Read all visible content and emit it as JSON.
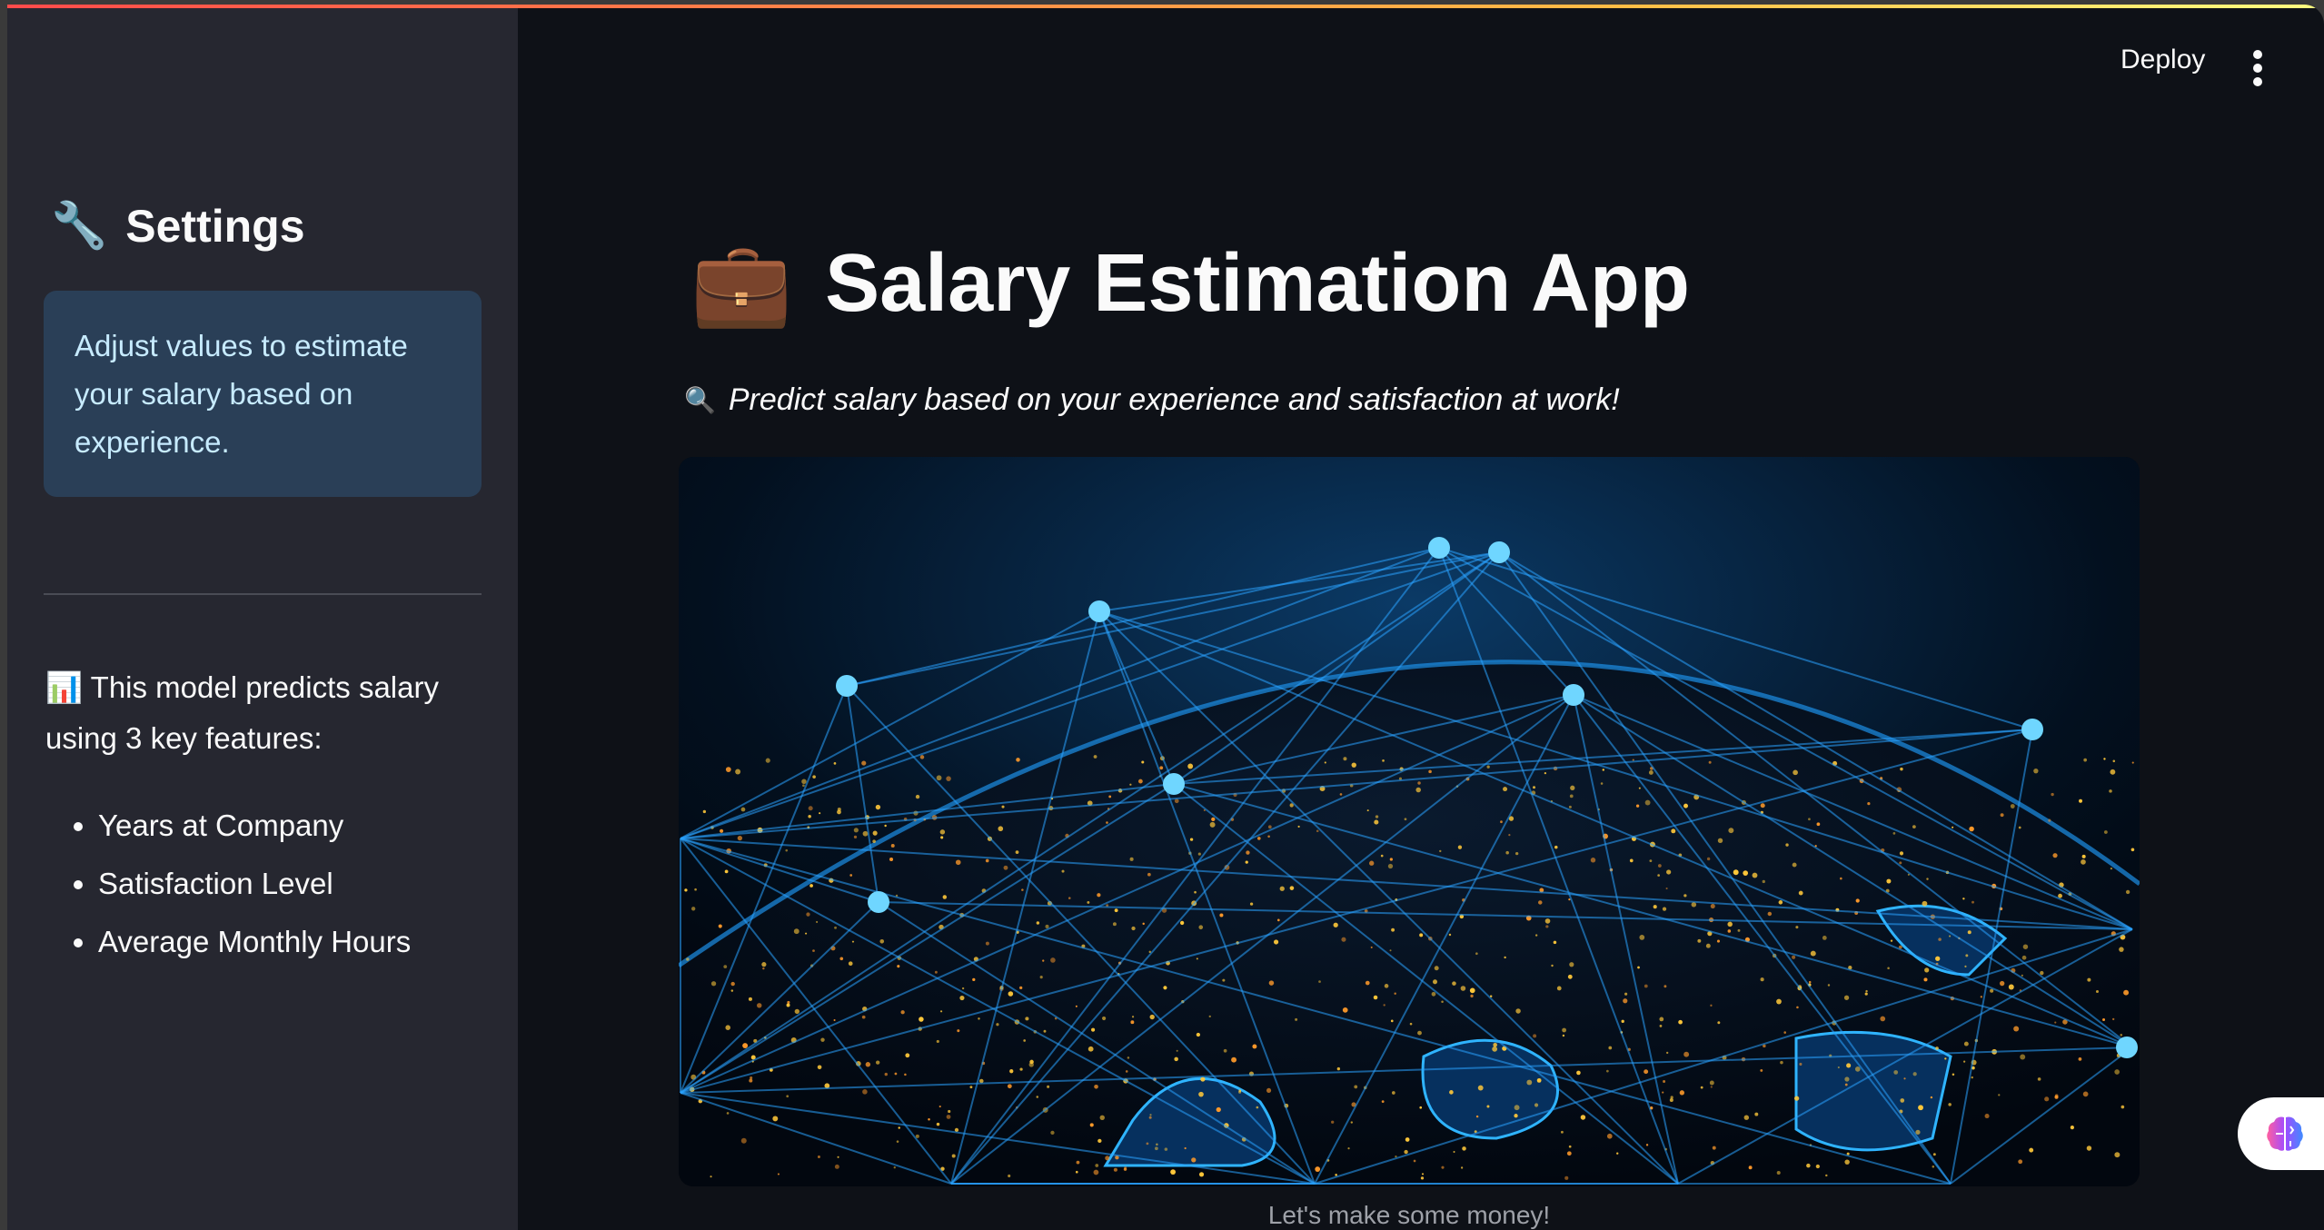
{
  "header": {
    "deploy_label": "Deploy",
    "menu_icon": "kebab-menu-icon"
  },
  "sidebar": {
    "title_icon": "🔧",
    "title": "Settings",
    "info": "Adjust values to estimate your salary based on experience.",
    "model_icon": "📊",
    "model_text": "This model predicts salary using 3 key features:",
    "features": [
      "Years at Company",
      "Satisfaction Level",
      "Average Monthly Hours"
    ]
  },
  "main": {
    "title_icon": "💼",
    "title": "Salary Estimation App",
    "subtitle_icon": "🔍",
    "subtitle": "Predict salary based on your experience and satisfaction at work!",
    "image_caption": "Let's make some money!"
  },
  "colors": {
    "accent_gradient_start": "#ff4b4b",
    "accent_gradient_end": "#fffd80",
    "sidebar_bg": "#262730",
    "main_bg": "#0e1117",
    "info_bg": "#2a3f57"
  }
}
